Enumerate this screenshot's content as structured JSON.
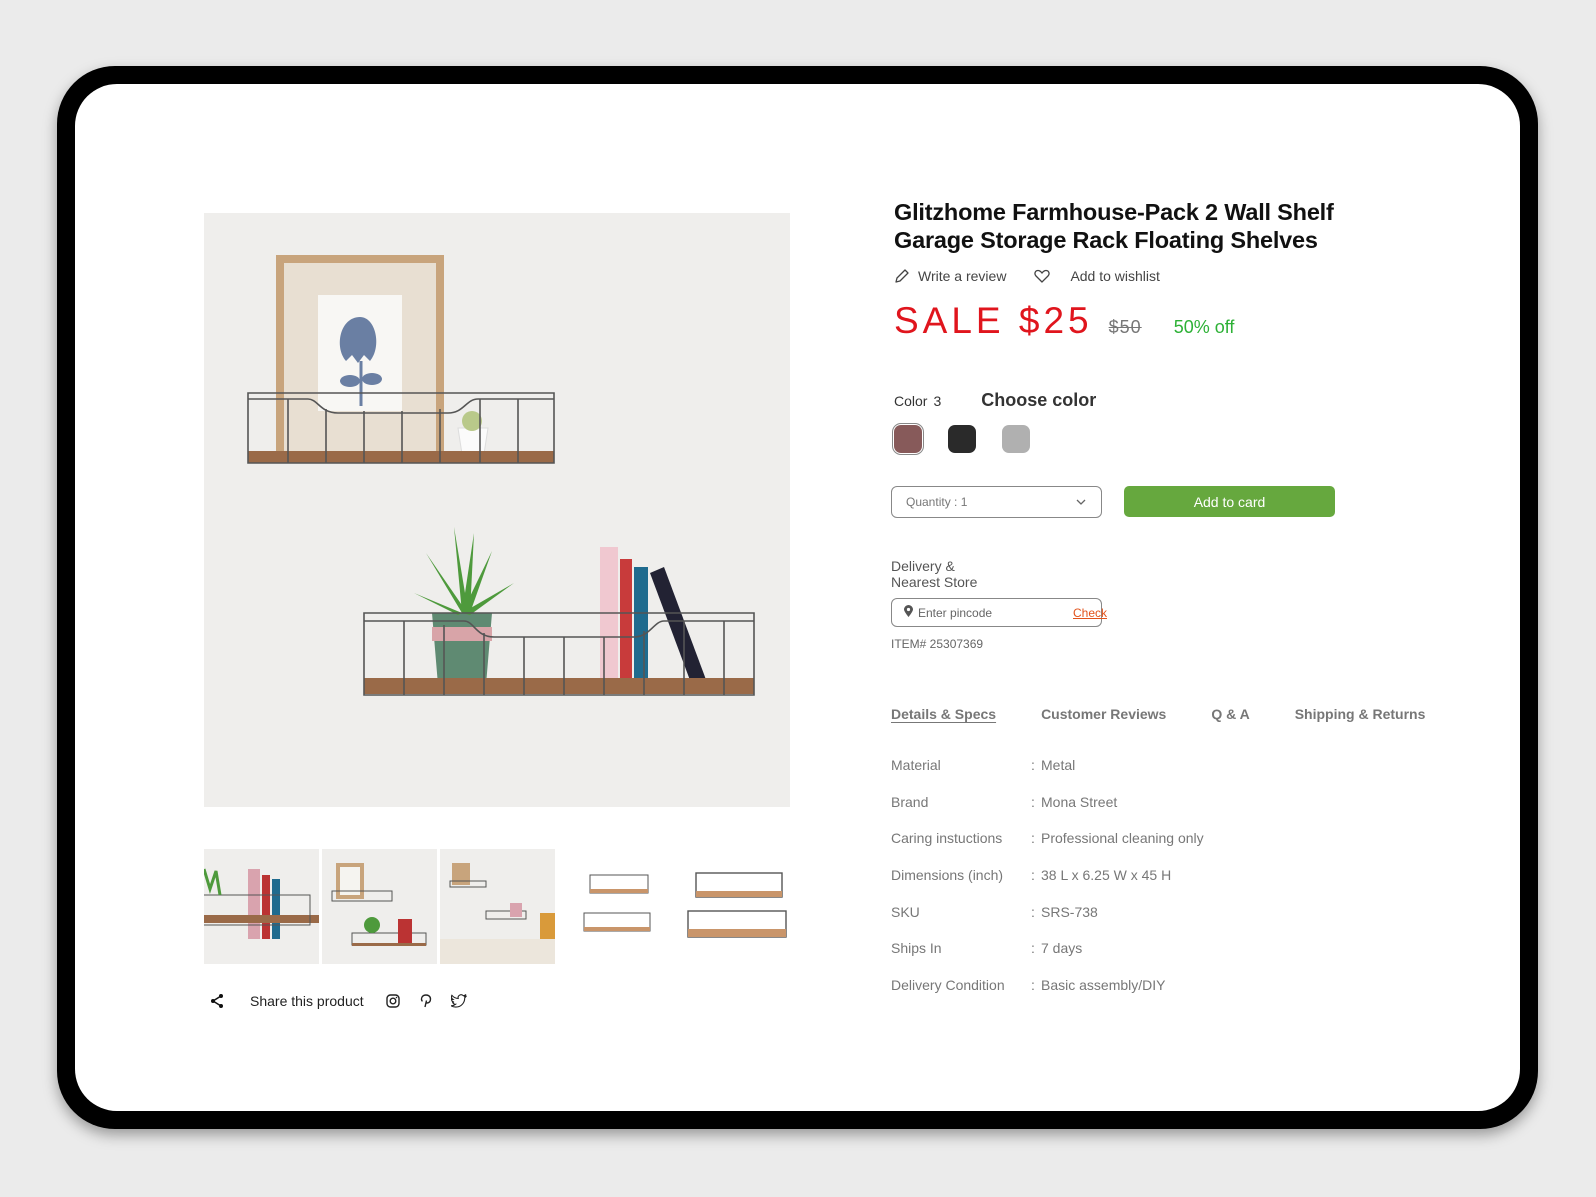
{
  "product": {
    "title_line1": "Glitzhome Farmhouse-Pack 2 Wall Shelf",
    "title_line2": "Garage Storage Rack Floating Shelves",
    "write_review": "Write a review",
    "add_to_wishlist": "Add to wishlist",
    "sale_price": "SALE $25",
    "original_price": "$50",
    "discount": "50% off"
  },
  "color": {
    "label": "Color",
    "count": "3",
    "heading": "Choose color",
    "swatches": [
      {
        "name": "mauve",
        "hex": "#875a5a",
        "selected": true
      },
      {
        "name": "black",
        "hex": "#2a2a2a",
        "selected": false
      },
      {
        "name": "gray",
        "hex": "#b0b0b0",
        "selected": false
      }
    ]
  },
  "purchase": {
    "quantity_label": "Quantity : 1",
    "add_button": "Add to card",
    "accent": "#66a83e"
  },
  "delivery": {
    "label_line1": "Delivery &",
    "label_line2": "Nearest Store",
    "pincode_placeholder": "Enter pincode",
    "check_label": "Check",
    "item_number": "ITEM# 25307369"
  },
  "tabs": [
    {
      "label": "Details & Specs",
      "active": true
    },
    {
      "label": "Customer Reviews",
      "active": false
    },
    {
      "label": "Q & A",
      "active": false
    },
    {
      "label": "Shipping & Returns",
      "active": false
    }
  ],
  "specs": [
    {
      "key": "Material",
      "value": "Metal"
    },
    {
      "key": "Brand",
      "value": "Mona Street"
    },
    {
      "key": "Caring instuctions",
      "value": "Professional cleaning only"
    },
    {
      "key": "Dimensions (inch)",
      "value": "38 L x 6.25 W x 45 H"
    },
    {
      "key": "SKU",
      "value": "SRS-738"
    },
    {
      "key": "Ships In",
      "value": "7 days"
    },
    {
      "key": "Delivery Condition",
      "value": "Basic assembly/DIY"
    }
  ],
  "gallery": {
    "thumbnails": [
      "shelf-with-books-closeup",
      "two-shelves-plant-frame",
      "shelves-living-room",
      "shelf-dimensions-diagram",
      "two-shelves-product"
    ]
  },
  "share": {
    "label": "Share this product",
    "networks": [
      "instagram",
      "pinterest",
      "twitter"
    ]
  }
}
